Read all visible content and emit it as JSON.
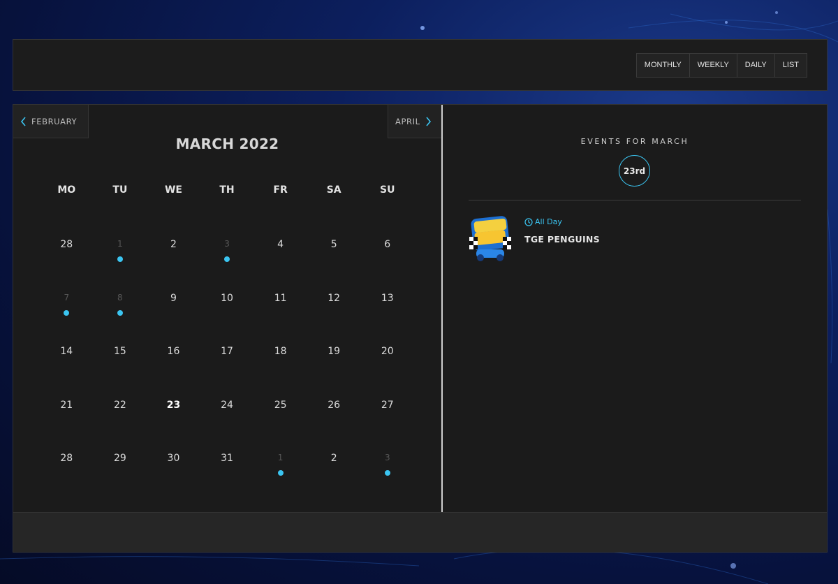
{
  "theme": {
    "accent": "#3bc5f1",
    "panel": "#1b1b1b",
    "background": "#0c1f5e"
  },
  "toolbar": {
    "views": [
      "MONTHLY",
      "WEEKLY",
      "DAILY",
      "LIST"
    ]
  },
  "calendar": {
    "prev_label": "FEBRUARY",
    "next_label": "APRIL",
    "title": "MARCH 2022",
    "weekdays": [
      "MO",
      "TU",
      "WE",
      "TH",
      "FR",
      "SA",
      "SU"
    ],
    "weeks": [
      [
        {
          "d": "28",
          "dim": false,
          "dot": false
        },
        {
          "d": "1",
          "dim": true,
          "dot": true
        },
        {
          "d": "2",
          "dim": false,
          "dot": false
        },
        {
          "d": "3",
          "dim": true,
          "dot": true
        },
        {
          "d": "4",
          "dim": false,
          "dot": false
        },
        {
          "d": "5",
          "dim": false,
          "dot": false
        },
        {
          "d": "6",
          "dim": false,
          "dot": false
        }
      ],
      [
        {
          "d": "7",
          "dim": true,
          "dot": true
        },
        {
          "d": "8",
          "dim": true,
          "dot": true
        },
        {
          "d": "9",
          "dim": false,
          "dot": false
        },
        {
          "d": "10",
          "dim": false,
          "dot": false
        },
        {
          "d": "11",
          "dim": false,
          "dot": false
        },
        {
          "d": "12",
          "dim": false,
          "dot": false
        },
        {
          "d": "13",
          "dim": false,
          "dot": false
        }
      ],
      [
        {
          "d": "14",
          "dim": false,
          "dot": false
        },
        {
          "d": "15",
          "dim": false,
          "dot": false
        },
        {
          "d": "16",
          "dim": false,
          "dot": false
        },
        {
          "d": "17",
          "dim": false,
          "dot": false
        },
        {
          "d": "18",
          "dim": false,
          "dot": false
        },
        {
          "d": "19",
          "dim": false,
          "dot": false
        },
        {
          "d": "20",
          "dim": false,
          "dot": false
        }
      ],
      [
        {
          "d": "21",
          "dim": false,
          "dot": false
        },
        {
          "d": "22",
          "dim": false,
          "dot": false
        },
        {
          "d": "23",
          "dim": false,
          "dot": false,
          "today": true
        },
        {
          "d": "24",
          "dim": false,
          "dot": false
        },
        {
          "d": "25",
          "dim": false,
          "dot": false
        },
        {
          "d": "26",
          "dim": false,
          "dot": false
        },
        {
          "d": "27",
          "dim": false,
          "dot": false
        }
      ],
      [
        {
          "d": "28",
          "dim": false,
          "dot": false
        },
        {
          "d": "29",
          "dim": false,
          "dot": false
        },
        {
          "d": "30",
          "dim": false,
          "dot": false
        },
        {
          "d": "31",
          "dim": false,
          "dot": false
        },
        {
          "d": "1",
          "dim": true,
          "dot": true
        },
        {
          "d": "2",
          "dim": false,
          "dot": false
        },
        {
          "d": "3",
          "dim": true,
          "dot": true
        }
      ]
    ]
  },
  "events": {
    "heading": "EVENTS FOR MARCH",
    "selected_date": "23rd",
    "items": [
      {
        "time": "All Day",
        "title": "TGE PENGUINS",
        "logo_icon": "penguin-karts-logo"
      }
    ]
  }
}
